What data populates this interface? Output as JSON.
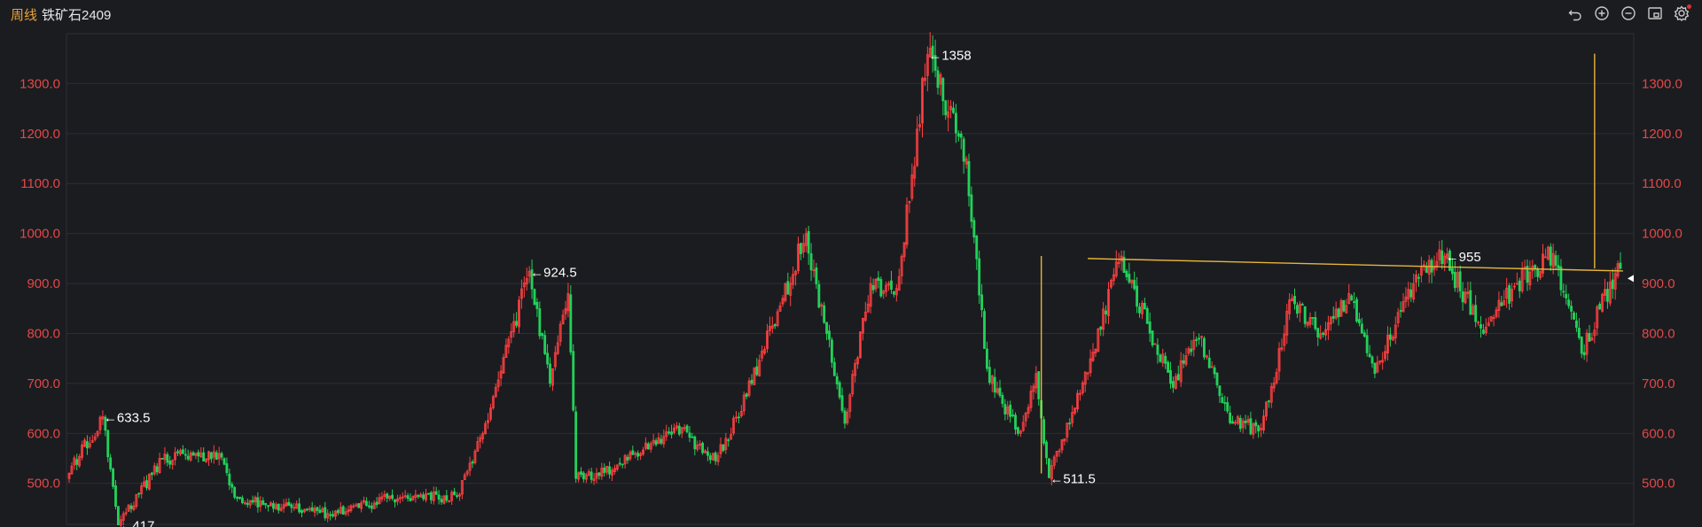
{
  "header": {
    "period": "周线",
    "symbol": "铁矿石2409"
  },
  "toolbar": {
    "icons": [
      "undo-icon",
      "zoom-in-icon",
      "zoom-out-icon",
      "window-icon",
      "settings-icon"
    ]
  },
  "colors": {
    "up": "#ff4040",
    "down": "#22d15a",
    "trendline": "#e6b43a",
    "axis_text": "#e04848",
    "background": "#1b1c20"
  },
  "chart_data": {
    "type": "candlestick",
    "ylim": [
      418,
      1400
    ],
    "y_ticks": [
      "1300.0",
      "1200.0",
      "1100.0",
      "1000.0",
      "900.0",
      "800.0",
      "700.0",
      "600.0",
      "500.0"
    ],
    "y_tick_values": [
      1300,
      1200,
      1100,
      1000,
      900,
      800,
      700,
      600,
      500
    ],
    "grid": true,
    "annotations": [
      {
        "index": 13,
        "price": 633.5,
        "text": "←633.5"
      },
      {
        "index": 19,
        "price": 417,
        "text": "←417"
      },
      {
        "index": 178,
        "price": 924.5,
        "text": "←924.5"
      },
      {
        "index": 332,
        "price": 1358,
        "text": "←1358"
      },
      {
        "index": 379,
        "price": 511.5,
        "text": "←511.5"
      },
      {
        "index": 532,
        "price": 955,
        "text": "←955"
      }
    ],
    "key_points": [
      [
        0,
        520
      ],
      [
        13,
        633.5
      ],
      [
        19,
        417
      ],
      [
        36,
        550
      ],
      [
        58,
        560
      ],
      [
        65,
        470
      ],
      [
        100,
        440
      ],
      [
        125,
        470
      ],
      [
        150,
        475
      ],
      [
        160,
        600
      ],
      [
        178,
        924.5
      ],
      [
        186,
        700
      ],
      [
        193,
        880
      ],
      [
        196,
        510
      ],
      [
        211,
        530
      ],
      [
        219,
        560
      ],
      [
        235,
        615
      ],
      [
        250,
        545
      ],
      [
        264,
        700
      ],
      [
        285,
        1000
      ],
      [
        300,
        620
      ],
      [
        310,
        900
      ],
      [
        320,
        890
      ],
      [
        332,
        1358
      ],
      [
        347,
        1150
      ],
      [
        355,
        730
      ],
      [
        367,
        600
      ],
      [
        374,
        720
      ],
      [
        379,
        511.5
      ],
      [
        391,
        680
      ],
      [
        407,
        955
      ],
      [
        426,
        700
      ],
      [
        437,
        790
      ],
      [
        450,
        620
      ],
      [
        461,
        610
      ],
      [
        473,
        870
      ],
      [
        484,
        800
      ],
      [
        495,
        880
      ],
      [
        505,
        720
      ],
      [
        520,
        900
      ],
      [
        532,
        955
      ],
      [
        547,
        800
      ],
      [
        560,
        900
      ],
      [
        574,
        960
      ],
      [
        585,
        760
      ],
      [
        598,
        920
      ]
    ],
    "trendline": {
      "from": [
        394,
        950
      ],
      "to": [
        601,
        925
      ]
    },
    "vertical_markers": [
      {
        "index": 376,
        "from": 520,
        "to": 955
      },
      {
        "index": 590,
        "from": 930,
        "to": 1360
      }
    ],
    "last_price": 910,
    "candle_count": 601
  }
}
